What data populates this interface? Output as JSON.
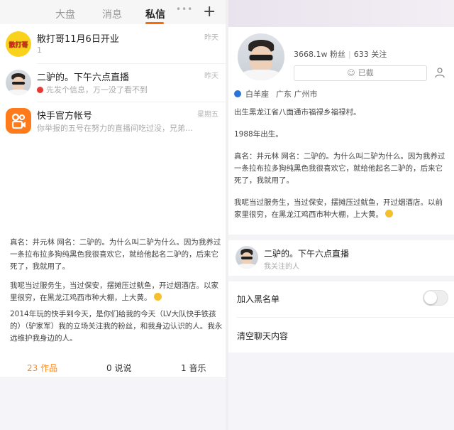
{
  "left": {
    "tabs": [
      {
        "label": "大盘"
      },
      {
        "label": "消息"
      },
      {
        "label": "私信"
      }
    ],
    "messages": [
      {
        "name": "散打哥11月6日开业",
        "sub": "1",
        "time": "昨天",
        "avatar_text": "散打哥"
      },
      {
        "name": "二驴的。下午六点直播",
        "sub": "先发个信息，万一没了看不到",
        "time": "昨天"
      },
      {
        "name": "快手官方帐号",
        "sub": "你举报的五号在努力的直播间吃过没，兄弟…",
        "time": "星期五"
      }
    ],
    "bio": [
      "真名：井元林 网名：二驴的。为什么叫二驴为什么。因为我养过一条拉布拉多狗纯黑色我很喜欢它，就给他起名二驴的，后来它死了，我就用了。",
      "我呢当过服务生，当过保安，摆摊压过鱿鱼，开过烟酒店。以家里很穷，在黑龙江鸡西市种大棚，上大黄。",
      "2014年玩的快手到今天，是你们给我的今天（LV大队快手铁孩的）（驴家军）我的立场关注我的粉丝，和我身边认识的人。我永远维护我身边的人。"
    ],
    "stats": [
      {
        "label": "23 作品"
      },
      {
        "label": "0 说说"
      },
      {
        "label": "1 音乐"
      }
    ]
  },
  "right": {
    "fans": "3668.1w 粉丝",
    "following": "633 关注",
    "follow_state": "已截",
    "tag": "白羊座",
    "location": "广东 广州市",
    "bio": [
      "出生黑龙江省八面通市福禄乡福禄村。",
      "1988年出生。",
      "真名：井元林 网名：二驴的。为什么叫二驴为什么。因为我养过一条拉布拉多狗纯黑色我很喜欢它，就给他起名二驴的，后来它死了，我就用了。",
      "我呢当过服务生，当过保安，摆摊压过鱿鱼，开过烟酒店。以前家里很穷，在黑龙江鸡西市种大棚，上大黄。"
    ],
    "contact": {
      "name": "二驴的。下午六点直播",
      "sub": "我关注的人"
    },
    "settings": [
      {
        "label": "加入黑名单"
      },
      {
        "label": "清空聊天内容"
      }
    ]
  },
  "colors": {
    "accent": "#ff8a1e",
    "unread": "#e53935",
    "tag_dot": "#2a73d8"
  }
}
